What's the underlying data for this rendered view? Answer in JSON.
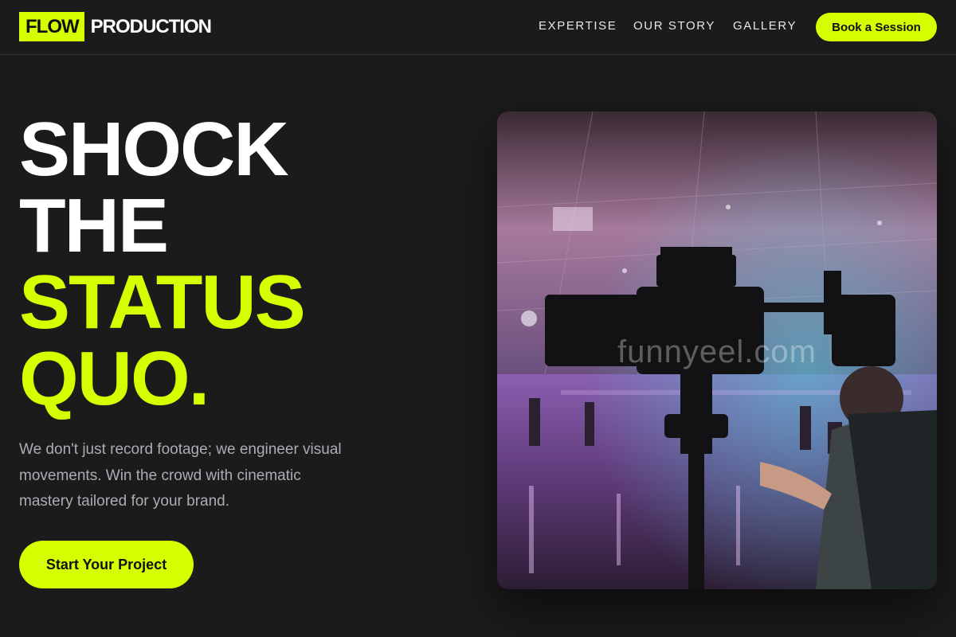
{
  "brand": {
    "logo_box": "FLOW",
    "logo_word": "PRODUCTION",
    "accent_color": "#d4ff00"
  },
  "nav": {
    "items": [
      "EXPERTISE",
      "OUR STORY",
      "GALLERY"
    ],
    "cta_label": "Book a Session"
  },
  "hero": {
    "title_lines": [
      "SHOCK",
      "THE",
      "STATUS",
      "QUO."
    ],
    "subtitle": "We don't just record footage; we engineer visual movements. Win the crowd with cinematic mastery tailored for your brand.",
    "cta_label": "Start Your Project"
  },
  "image": {
    "watermark": "funnyeel.com",
    "subject": "camera-operator-photo"
  }
}
